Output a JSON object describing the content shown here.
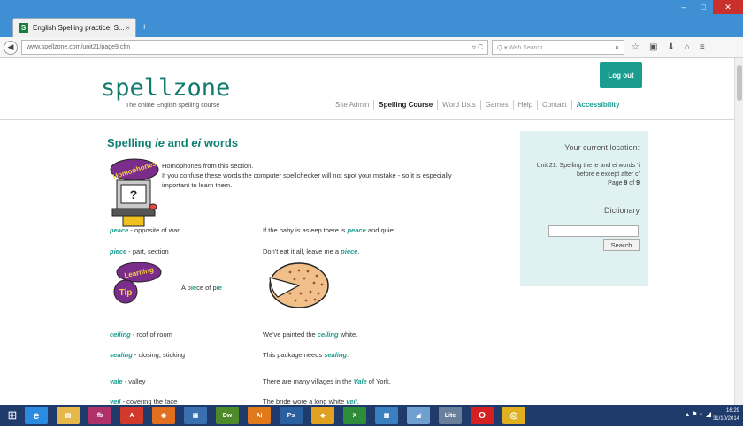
{
  "browser": {
    "tab_title": "English Spelling practice: S...",
    "tab_favicon": "S",
    "tab_close": "×",
    "new_tab": "+",
    "url": "www.spellzone.com/unit21/page9.cfm",
    "url_icons": "▿ C",
    "search_placeholder": "Q ▾  Web Search",
    "back_icon": "◀"
  },
  "window_controls": {
    "minimize": "–",
    "maximize": "□",
    "close": "✕"
  },
  "toolbar_icons": [
    "☆",
    "▣",
    "⬇",
    "⌂",
    "≡"
  ],
  "site": {
    "logo": "spellzone",
    "tagline": "The online English spelling course",
    "logout_label": "Log out",
    "nav": [
      "Site Admin",
      "Spelling Course",
      "Word Lists",
      "Games",
      "Help",
      "Contact",
      "Accessibility"
    ]
  },
  "content": {
    "heading_pre": "Spelling ",
    "heading_ie": "ie",
    "heading_and": " and ",
    "heading_ei": "ei",
    "heading_post": " words",
    "intro_line1": "Homophones from this section.",
    "intro_line2": "If you confuse these words the computer spellchecker will not spot your mistake - so it is especially important to learn them.",
    "badge_homophones": "Homophones",
    "badge_learning": "Learning",
    "badge_tip": "Tip",
    "tip_pre": "A p",
    "tip_hl1": "ie",
    "tip_mid": "ce of p",
    "tip_hl2": "ie",
    "rows": [
      {
        "word": "peace",
        "def": " - opposite of war",
        "sent_pre": "If the baby is asleep there is ",
        "sent_word": "peace",
        "sent_post": " and quiet."
      },
      {
        "word": "piece",
        "def": " - part, section",
        "sent_pre": "Don't eat it all, leave me a ",
        "sent_word": "piece",
        "sent_post": "."
      },
      {
        "word": "ceiling",
        "def": " - roof of room",
        "sent_pre": "We've painted the ",
        "sent_word": "ceiling",
        "sent_post": " white."
      },
      {
        "word": "sealing",
        "def": " - closing, sticking",
        "sent_pre": "This package needs ",
        "sent_word": "sealing",
        "sent_post": "."
      },
      {
        "word": "vale",
        "def": " - valley",
        "sent_pre": "There are many villages in the ",
        "sent_word": "Vale",
        "sent_post": " of York."
      },
      {
        "word": "veil",
        "def": " - covering the face",
        "sent_pre": "The bride wore a long white ",
        "sent_word": "veil",
        "sent_post": "."
      }
    ]
  },
  "sidebar": {
    "location_title": "Your current location:",
    "location_text": "Unit 21: Spelling the ie and ei words 'i before e except after c'",
    "page_pre": "Page ",
    "page_num": "9",
    "page_mid": " of ",
    "page_total": "9",
    "dictionary_title": "Dictionary",
    "search_button": "Search"
  },
  "taskbar": {
    "start": "⊞",
    "apps": [
      {
        "name": "ie",
        "label": "e",
        "color": "#2b8be0"
      },
      {
        "name": "explorer",
        "label": "▤",
        "color": "#e6b84a"
      },
      {
        "name": "fb",
        "label": "fb",
        "color": "#b0306a"
      },
      {
        "name": "acrobat",
        "label": "A",
        "color": "#d13a2a"
      },
      {
        "name": "firefox",
        "label": "◉",
        "color": "#e0701f"
      },
      {
        "name": "app6",
        "label": "▣",
        "color": "#3a6fb0"
      },
      {
        "name": "dreamweaver",
        "label": "Dw",
        "color": "#4f8a2a"
      },
      {
        "name": "illustrator",
        "label": "Ai",
        "color": "#e07a1a"
      },
      {
        "name": "photoshop",
        "label": "Ps",
        "color": "#2a5fa0"
      },
      {
        "name": "app10",
        "label": "◆",
        "color": "#e0a020"
      },
      {
        "name": "excel",
        "label": "X",
        "color": "#2e8b3a"
      },
      {
        "name": "app12",
        "label": "▦",
        "color": "#3a7fc0"
      },
      {
        "name": "app13",
        "label": "◢",
        "color": "#6fa0d0"
      },
      {
        "name": "app14",
        "label": "Lite",
        "color": "#6a7f9a"
      },
      {
        "name": "opera",
        "label": "O",
        "color": "#d42020"
      },
      {
        "name": "chrome",
        "label": "◎",
        "color": "#e0b020"
      }
    ],
    "tray": "▴ ⚑ ◐ ◢",
    "time": "16:29",
    "date": "31/10/2014"
  },
  "colors": {
    "accent": "#1a9c8f",
    "heading": "#0f7f74",
    "sidebar_bg": "#dff2f1",
    "taskbar": "#1f3b6b"
  }
}
